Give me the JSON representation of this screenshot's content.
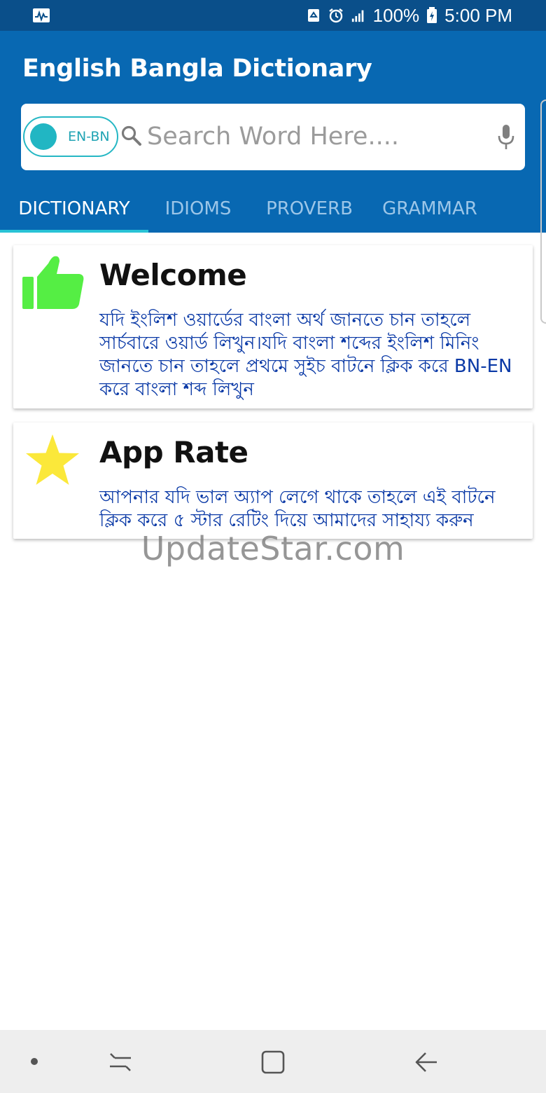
{
  "status_bar": {
    "battery": "100%",
    "time": "5:00 PM"
  },
  "header": {
    "title": "English Bangla Dictionary"
  },
  "search": {
    "toggle_label": "EN-BN",
    "placeholder": "Search Word Here...."
  },
  "tabs": [
    {
      "label": "DICTIONARY",
      "active": true
    },
    {
      "label": "IDIOMS",
      "active": false
    },
    {
      "label": "PROVERB",
      "active": false
    },
    {
      "label": "GRAMMAR",
      "active": false
    }
  ],
  "cards": [
    {
      "title": "Welcome",
      "body": "যদি ইংলিশ ওয়ার্ডের বাংলা অর্থ জানতে চান তাহলে সার্চবারে ওয়ার্ড লিখুন।যদি বাংলা শব্দের ইংলিশ মিনিং জানতে চান তাহলে প্রথমে সুইচ বাটনে ক্লিক করে BN-EN করে বাংলা শব্দ লিখুন",
      "icon": "thumbs-up-icon"
    },
    {
      "title": "App Rate",
      "body": "আপনার যদি ভাল অ্যাপ লেগে থাকে তাহলে এই বাটনে ক্লিক করে ৫ স্টার রেটিং দিয়ে আমাদের সাহায্য করুন",
      "icon": "star-icon"
    }
  ],
  "watermark": "UpdateStar.com",
  "colors": {
    "status_bar": "#0a4f8a",
    "app_bar": "#0868b2",
    "accent": "#29c3d6",
    "thumbs_up": "#55ee44",
    "star": "#fbe83a",
    "body_text": "#0a39a6"
  }
}
